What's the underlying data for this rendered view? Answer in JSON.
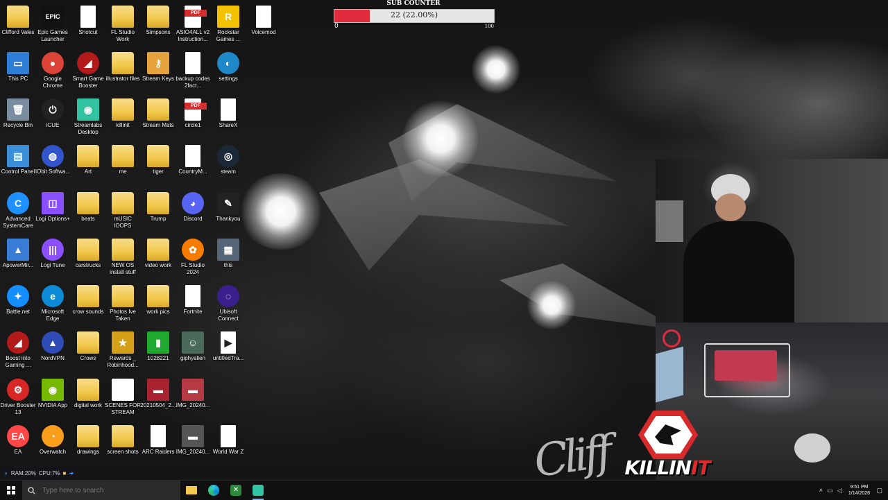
{
  "desktop": {
    "icons": [
      {
        "label": "Clifford Vales",
        "type": "folder",
        "glyph": ""
      },
      {
        "label": "Epic Games Launcher",
        "type": "app",
        "glyph": "EPIC",
        "bg": "#111111"
      },
      {
        "label": "Shotcut",
        "type": "doc",
        "glyph": ""
      },
      {
        "label": "FL Studio Work",
        "type": "folder",
        "glyph": ""
      },
      {
        "label": "Simpsons",
        "type": "folder",
        "glyph": ""
      },
      {
        "label": "ASIO4ALL v2 Instruction...",
        "type": "pdf",
        "glyph": "PDF"
      },
      {
        "label": "Rockstar Games ...",
        "type": "app",
        "glyph": "R",
        "bg": "#f2c200"
      },
      {
        "label": "Voicemod",
        "type": "doc",
        "glyph": ""
      },
      {
        "label": "This PC",
        "type": "app",
        "glyph": "▭",
        "bg": "#2f7fd8"
      },
      {
        "label": "Google Chrome",
        "type": "circle",
        "glyph": "●",
        "bg": "#db4437"
      },
      {
        "label": "Smart Game Booster",
        "type": "circle",
        "glyph": "◢",
        "bg": "#b31b1b"
      },
      {
        "label": "illustrator files",
        "type": "folder",
        "glyph": ""
      },
      {
        "label": "Stream Keys",
        "type": "app",
        "glyph": "⚷",
        "bg": "#e6a23c"
      },
      {
        "label": "backup codes 2fact...",
        "type": "doc",
        "glyph": ""
      },
      {
        "label": "settings",
        "type": "circle",
        "glyph": "◐",
        "bg": "#1e88c8"
      },
      {
        "label": "Recycle Bin",
        "type": "app",
        "glyph": "🗑",
        "bg": "#7a8da0"
      },
      {
        "label": "iCUE",
        "type": "circle",
        "glyph": "⏻",
        "bg": "#222222"
      },
      {
        "label": "Streamlabs Desktop",
        "type": "app",
        "glyph": "◉",
        "bg": "#31c3a2"
      },
      {
        "label": "killinit",
        "type": "folder",
        "glyph": ""
      },
      {
        "label": "Stream Mats",
        "type": "folder",
        "glyph": ""
      },
      {
        "label": "circle1",
        "type": "pdf",
        "glyph": "PDF"
      },
      {
        "label": "ShareX",
        "type": "doc",
        "glyph": ""
      },
      {
        "label": "Control Panel",
        "type": "app",
        "glyph": "▤",
        "bg": "#3a8fd8"
      },
      {
        "label": "IObit Softwa...",
        "type": "circle",
        "glyph": "◍",
        "bg": "#3355cc"
      },
      {
        "label": "Art",
        "type": "folder",
        "glyph": ""
      },
      {
        "label": "me",
        "type": "folder",
        "glyph": ""
      },
      {
        "label": "tiger",
        "type": "folder",
        "glyph": ""
      },
      {
        "label": "CountryM...",
        "type": "doc",
        "glyph": ""
      },
      {
        "label": "steam",
        "type": "circle",
        "glyph": "◎",
        "bg": "#1b2838"
      },
      {
        "label": "Advanced SystemCare",
        "type": "circle",
        "glyph": "C",
        "bg": "#1e90ff"
      },
      {
        "label": "Logi Options+",
        "type": "app",
        "glyph": "◫",
        "bg": "#8a4fff"
      },
      {
        "label": "beats",
        "type": "folder",
        "glyph": ""
      },
      {
        "label": "mUSIC lOOPS",
        "type": "folder",
        "glyph": ""
      },
      {
        "label": "Trump",
        "type": "folder",
        "glyph": ""
      },
      {
        "label": "Discord",
        "type": "circle",
        "glyph": "◕",
        "bg": "#5865f2"
      },
      {
        "label": "Thankyou",
        "type": "app",
        "glyph": "✎",
        "bg": "#222222"
      },
      {
        "label": "ApowerMir...",
        "type": "app",
        "glyph": "▲",
        "bg": "#3a7bd5"
      },
      {
        "label": "Logi Tune",
        "type": "circle",
        "glyph": "|||",
        "bg": "#8a4fff"
      },
      {
        "label": "carstrucks",
        "type": "folder",
        "glyph": ""
      },
      {
        "label": "NEW OS install stuff",
        "type": "folder",
        "glyph": ""
      },
      {
        "label": "video work",
        "type": "folder",
        "glyph": ""
      },
      {
        "label": "FL Studio 2024",
        "type": "circle",
        "glyph": "✿",
        "bg": "#f57c00"
      },
      {
        "label": "this",
        "type": "app",
        "glyph": "▦",
        "bg": "#556677"
      },
      {
        "label": "Battle.net",
        "type": "circle",
        "glyph": "✦",
        "bg": "#148eff"
      },
      {
        "label": "Microsoft Edge",
        "type": "circle",
        "glyph": "e",
        "bg": "#0c8ad6"
      },
      {
        "label": "crow sounds",
        "type": "folder",
        "glyph": ""
      },
      {
        "label": "Photos Ive Taken",
        "type": "folder",
        "glyph": ""
      },
      {
        "label": "work pics",
        "type": "folder",
        "glyph": ""
      },
      {
        "label": "Fortnite",
        "type": "doc",
        "glyph": ""
      },
      {
        "label": "Ubisoft Connect",
        "type": "circle",
        "glyph": "◌",
        "bg": "#3a1f8c"
      },
      {
        "label": "Boost into Gaming ...",
        "type": "circle",
        "glyph": "◢",
        "bg": "#b31b1b"
      },
      {
        "label": "NordVPN",
        "type": "circle",
        "glyph": "▲",
        "bg": "#2f4cb6"
      },
      {
        "label": "Crows",
        "type": "folder",
        "glyph": ""
      },
      {
        "label": "Rewards _ Robinhood...",
        "type": "app",
        "glyph": "★",
        "bg": "#d4a017"
      },
      {
        "label": "1028221",
        "type": "app",
        "glyph": "▮",
        "bg": "#1faa2f"
      },
      {
        "label": "giphyalien",
        "type": "app",
        "glyph": "☺",
        "bg": "#4a6a5a"
      },
      {
        "label": "untitledTra...",
        "type": "doc",
        "glyph": "▶"
      },
      {
        "label": "Driver Booster 13",
        "type": "circle",
        "glyph": "⚙",
        "bg": "#d82727"
      },
      {
        "label": "NVIDIA App",
        "type": "app",
        "glyph": "◉",
        "bg": "#76b900"
      },
      {
        "label": "digital work",
        "type": "folder",
        "glyph": ""
      },
      {
        "label": "SCENES FOR STREAM",
        "type": "app",
        "glyph": "▦",
        "bg": "#ffffff"
      },
      {
        "label": "20210504_2...",
        "type": "app",
        "glyph": "▬",
        "bg": "#a8232f"
      },
      {
        "label": "IMG_20240...",
        "type": "app",
        "glyph": "▬",
        "bg": "#b53a44"
      },
      {
        "label": "EA",
        "type": "circle",
        "glyph": "EA",
        "bg": "#ff4747"
      },
      {
        "label": "Overwatch",
        "type": "circle",
        "glyph": "◔",
        "bg": "#f99e1a"
      },
      {
        "label": "drawings",
        "type": "folder",
        "glyph": ""
      },
      {
        "label": "screen shots",
        "type": "folder",
        "glyph": ""
      },
      {
        "label": "ARC Raiders",
        "type": "doc",
        "glyph": ""
      },
      {
        "label": "IMG_20240...",
        "type": "app",
        "glyph": "▬",
        "bg": "#555555"
      },
      {
        "label": "World War Z",
        "type": "doc",
        "glyph": ""
      }
    ]
  },
  "sub_counter": {
    "title": "SUB COUNTER",
    "value_text": "22 (22.00%)",
    "current": 22,
    "percent": 22.0,
    "min": "0",
    "max": "100",
    "fill_color": "#e02b3d"
  },
  "overlay": {
    "logo_text_a": "KILLIN",
    "logo_text_b": "IT"
  },
  "status_strip": {
    "ram": "RAM:20%",
    "cpu": "CPU:7%"
  },
  "taskbar": {
    "search_placeholder": "Type here to search",
    "clock_time": "9:51 PM",
    "clock_date": "1/14/2026",
    "pinned": [
      "file-explorer-icon",
      "edge-icon",
      "xbox-icon",
      "streamlabs-icon"
    ]
  }
}
